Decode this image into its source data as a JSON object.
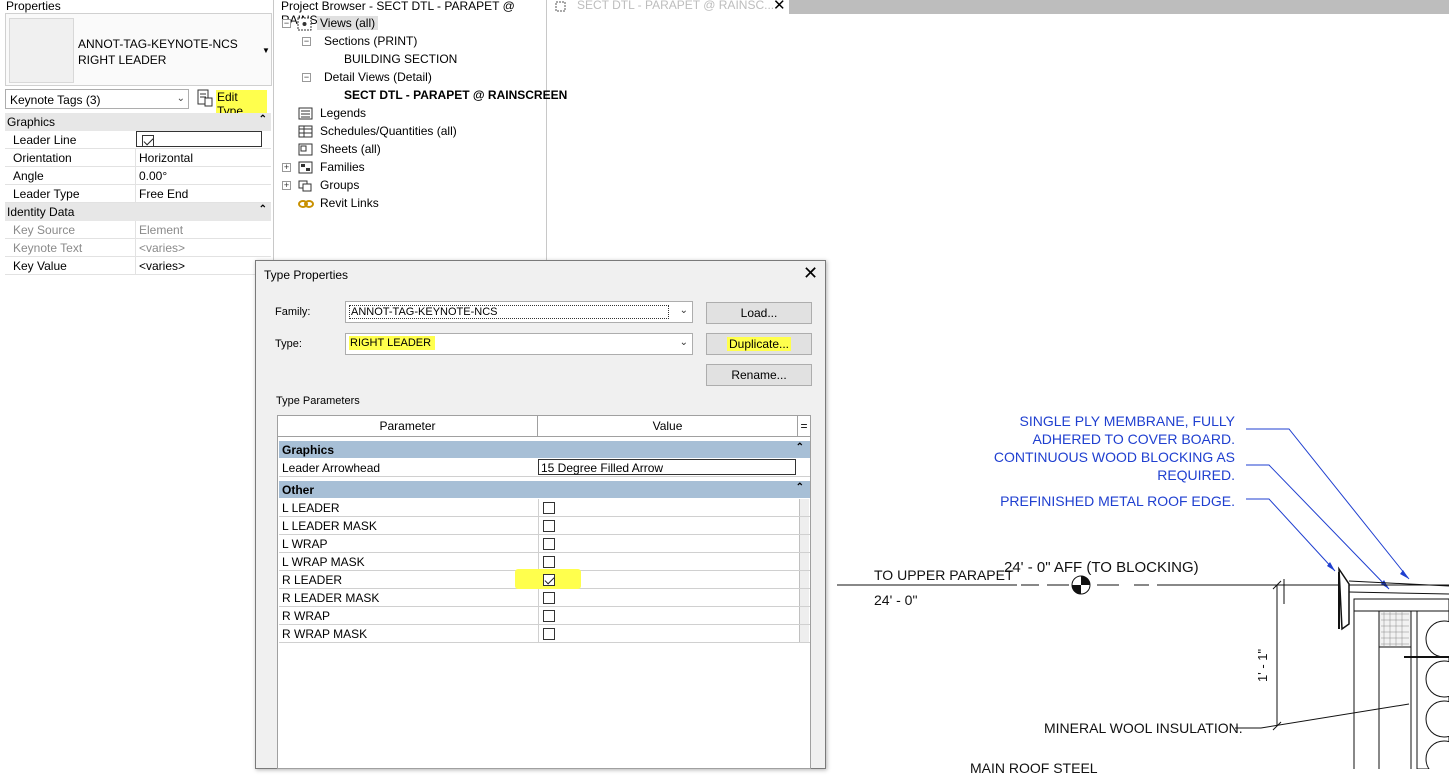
{
  "properties": {
    "title": "Properties",
    "type_family": "ANNOT-TAG-KEYNOTE-NCS",
    "type_name": "RIGHT LEADER",
    "filter": "Keynote Tags (3)",
    "edit_type": "Edit Type",
    "graphics": {
      "section": "Graphics",
      "rows": [
        {
          "key": "Leader Line",
          "value": "",
          "checked": true
        },
        {
          "key": "Orientation",
          "value": "Horizontal"
        },
        {
          "key": "Angle",
          "value": "0.00°"
        },
        {
          "key": "Leader Type",
          "value": "Free End"
        }
      ]
    },
    "identity": {
      "section": "Identity Data",
      "rows": [
        {
          "key": "Key Source",
          "value": "Element",
          "disabled": true
        },
        {
          "key": "Keynote Text",
          "value": "<varies>",
          "disabled": true
        },
        {
          "key": "Key Value",
          "value": "<varies>"
        }
      ]
    }
  },
  "project_browser": {
    "title": "Project Browser - SECT DTL - PARAPET @ RAINS...",
    "items": [
      {
        "label": "Views (all)",
        "icon": "views-icon"
      },
      {
        "label": "Sections (PRINT)"
      },
      {
        "label": "BUILDING SECTION"
      },
      {
        "label": "Detail Views (Detail)"
      },
      {
        "label": "SECT DTL - PARAPET @ RAINSCREEN"
      },
      {
        "label": "Legends",
        "icon": "legends-icon"
      },
      {
        "label": "Schedules/Quantities (all)",
        "icon": "schedules-icon"
      },
      {
        "label": "Sheets (all)",
        "icon": "sheets-icon"
      },
      {
        "label": "Families",
        "icon": "families-icon"
      },
      {
        "label": "Groups",
        "icon": "groups-icon"
      },
      {
        "label": "Revit Links",
        "icon": "revit-links-icon"
      }
    ]
  },
  "view_tab": {
    "label": "SECT DTL - PARAPET @ RAINSC..."
  },
  "drawing": {
    "annotations": [
      "SINGLE PLY MEMBRANE, FULLY",
      "ADHERED TO COVER BOARD.",
      "CONTINUOUS WOOD BLOCKING AS",
      "REQUIRED.",
      "PREFINISHED METAL ROOF EDGE."
    ],
    "level_label": "TO UPPER PARAPET",
    "level_value": "24' - 0\"",
    "level_note": "24' - 0\" AFF (TO BLOCKING)",
    "dimension": "1' - 1\"",
    "mineral_wool": "MINERAL WOOL INSULATION.",
    "main_roof": "MAIN ROOF STEEL"
  },
  "dialog": {
    "title": "Type Properties",
    "family_label": "Family:",
    "family_value": "ANNOT-TAG-KEYNOTE-NCS",
    "type_label": "Type:",
    "type_value": "RIGHT LEADER",
    "load": "Load...",
    "duplicate": "Duplicate...",
    "rename": "Rename...",
    "type_params": "Type Parameters",
    "col_param": "Parameter",
    "col_value": "Value",
    "col_eq": "=",
    "graphics_section": "Graphics",
    "leader_arrowhead_key": "Leader Arrowhead",
    "leader_arrowhead_value": "15 Degree Filled Arrow",
    "other_section": "Other",
    "other_rows": [
      {
        "key": "L LEADER",
        "checked": false
      },
      {
        "key": "L LEADER MASK",
        "checked": false
      },
      {
        "key": "L WRAP",
        "checked": false
      },
      {
        "key": "L WRAP MASK",
        "checked": false
      },
      {
        "key": "R LEADER",
        "checked": true
      },
      {
        "key": "R LEADER MASK",
        "checked": false
      },
      {
        "key": "R WRAP",
        "checked": false
      },
      {
        "key": "R WRAP MASK",
        "checked": false
      }
    ]
  }
}
